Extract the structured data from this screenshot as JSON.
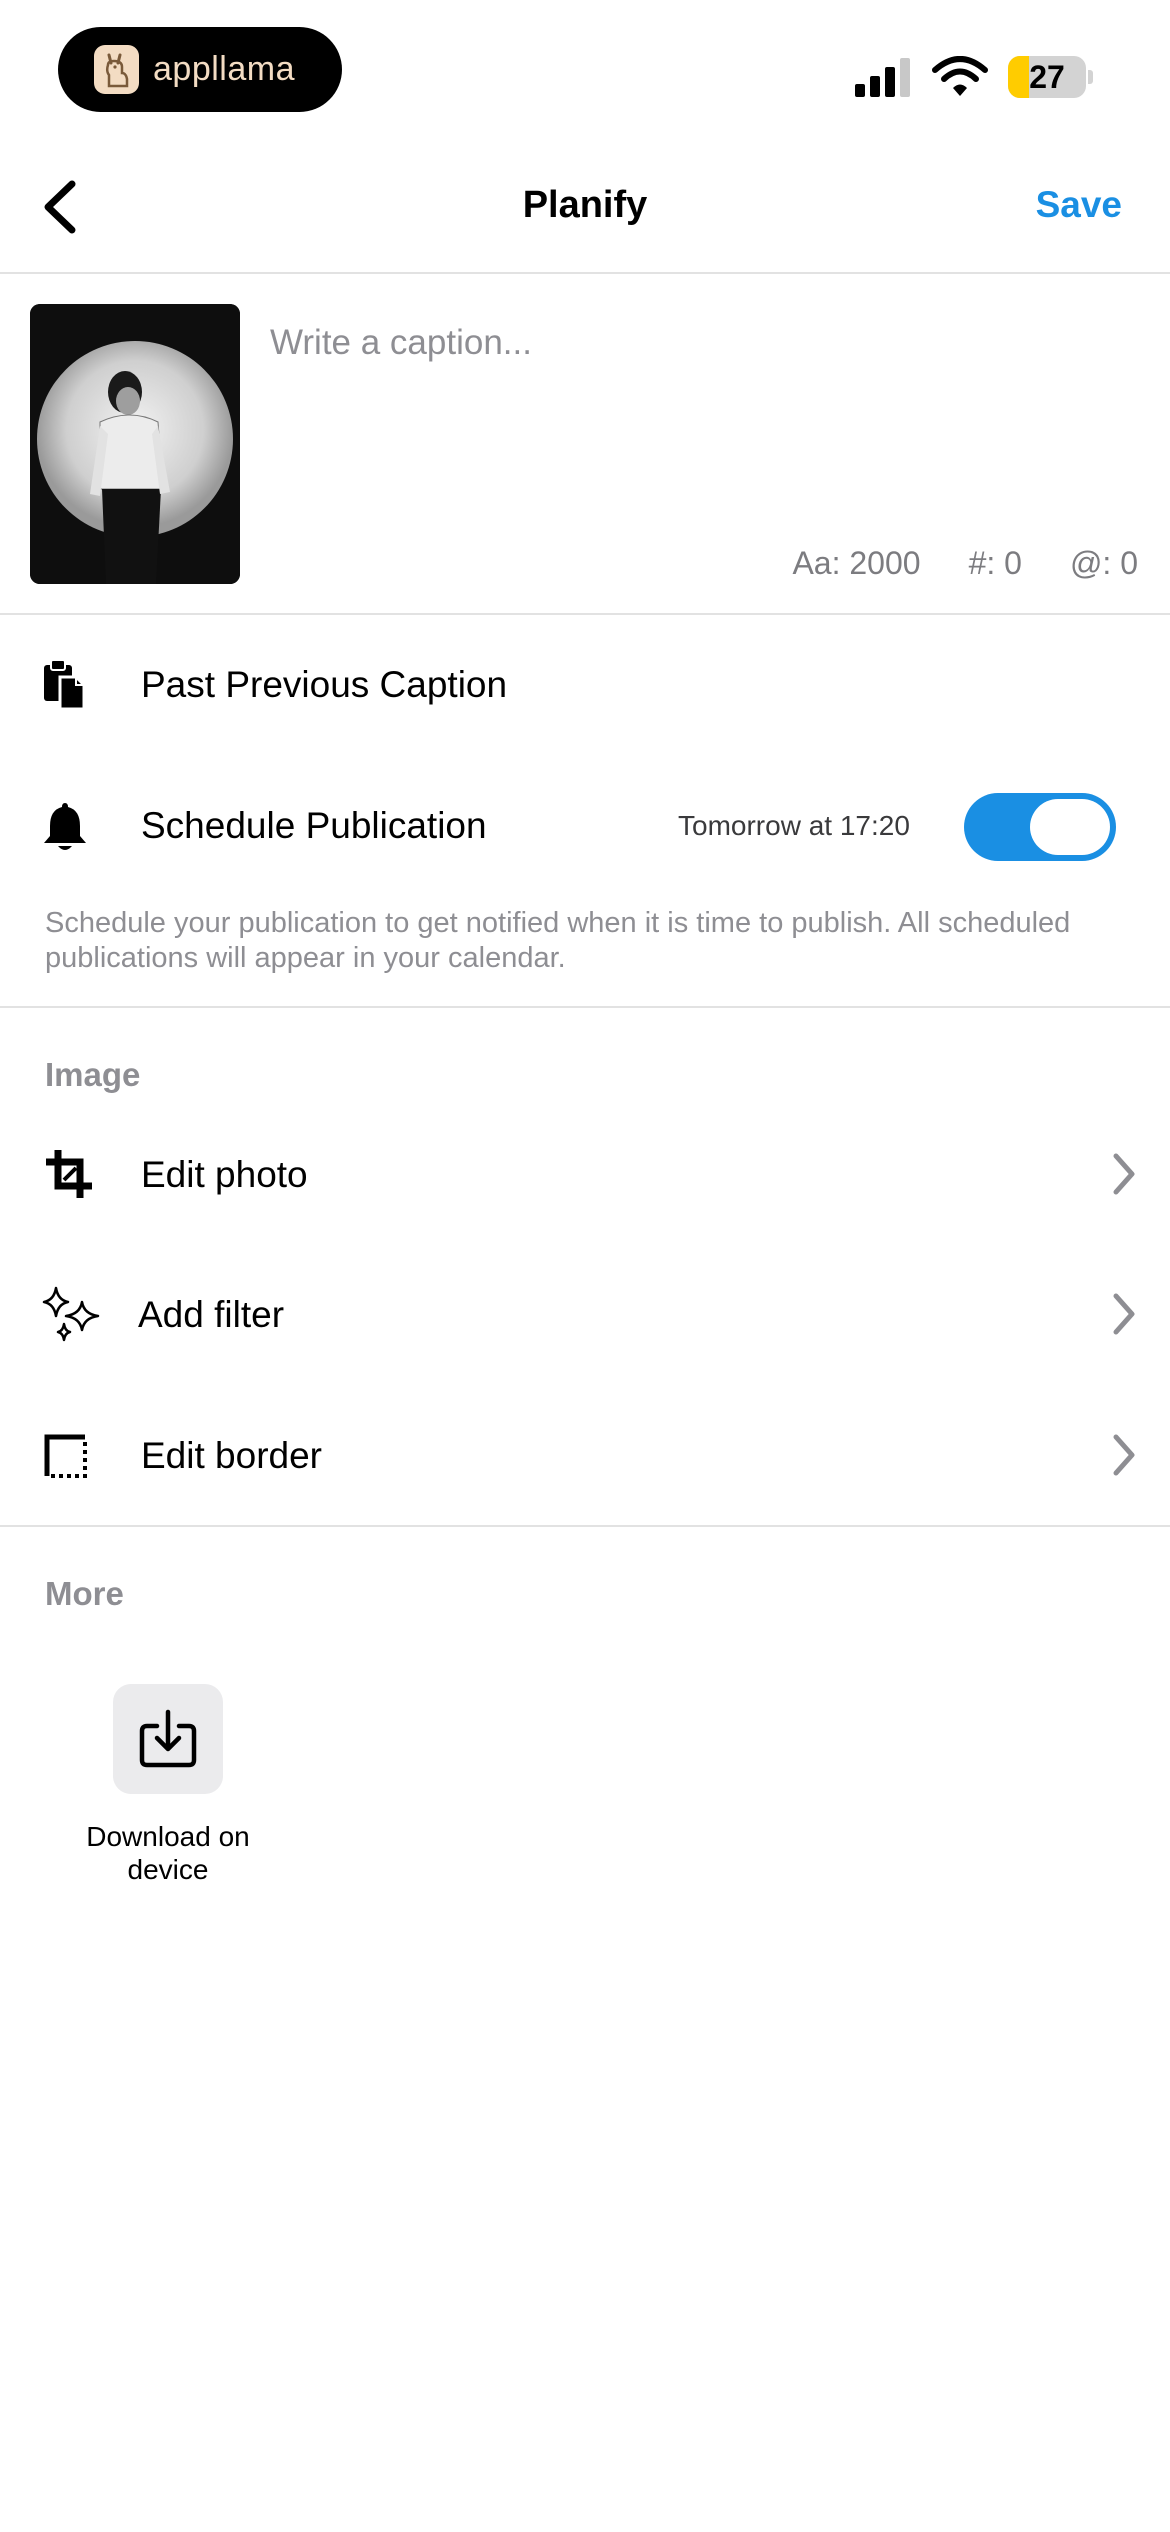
{
  "status_bar": {
    "app_badge_text": "appllama",
    "battery_level": "27",
    "battery_color": "#ffcc00",
    "battery_fraction": 0.27
  },
  "nav": {
    "back_icon": "chevron-left-icon",
    "title": "Planify",
    "save_label": "Save"
  },
  "caption": {
    "placeholder": "Write a caption...",
    "value": "",
    "counters": {
      "chars": "Aa: 2000",
      "hashtags": "#: 0",
      "mentions": "@: 0"
    }
  },
  "rows": {
    "paste": {
      "icon": "clipboard-icon",
      "label": "Past Previous Caption"
    },
    "schedule": {
      "icon": "bell-icon",
      "label": "Schedule Publication",
      "time": "Tomorrow at 17:20",
      "enabled": true,
      "hint": "Schedule your publication to get notified when it is time to publish. All scheduled publications will appear in your calendar."
    }
  },
  "image_section": {
    "title": "Image",
    "items": [
      {
        "icon": "crop-icon",
        "label": "Edit photo"
      },
      {
        "icon": "sparkles-icon",
        "label": "Add filter"
      },
      {
        "icon": "border-icon",
        "label": "Edit border"
      }
    ]
  },
  "more_section": {
    "title": "More",
    "download_label": "Download on device",
    "download_icon": "download-icon"
  },
  "colors": {
    "accent": "#1a8fe3",
    "secondary_text": "#8e8e93",
    "divider": "#e2e2e2"
  }
}
